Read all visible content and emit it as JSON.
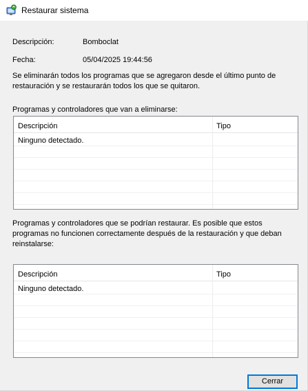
{
  "window": {
    "title": "Restaurar sistema",
    "icon": "system-restore-icon"
  },
  "info": {
    "description_label": "Descripción:",
    "description_value": "Bomboclat",
    "date_label": "Fecha:",
    "date_value": "05/04/2025 19:44:56"
  },
  "message": "Se eliminarán todos los programas que se agregaron desde el último punto de restauración y se restaurarán todos los que se quitaron.",
  "removed_section": {
    "label": "Programas y controladores que van a eliminarse:",
    "columns": [
      "Descripción",
      "Tipo"
    ],
    "rows": [
      [
        "Ninguno detectado.",
        ""
      ]
    ]
  },
  "restored_section": {
    "label": "Programas y controladores que se podrían restaurar. Es posible que estos programas no funcionen correctamente después de la restauración y que deban reinstalarse:",
    "columns": [
      "Descripción",
      "Tipo"
    ],
    "rows": [
      [
        "Ninguno detectado.",
        ""
      ]
    ]
  },
  "buttons": {
    "close": "Cerrar"
  }
}
